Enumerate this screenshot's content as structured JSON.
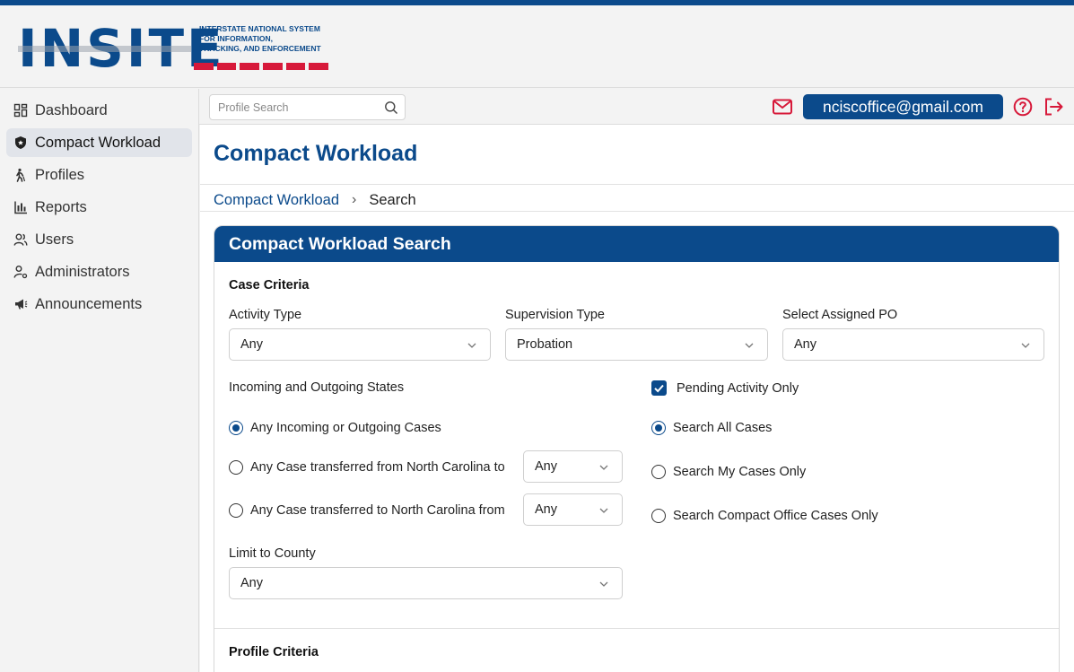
{
  "logo": {
    "word": "INSITE",
    "tagline": [
      "INTERSTATE NATIONAL SYSTEM",
      "FOR INFORMATION,",
      "TRACKING, AND ENFORCEMENT"
    ]
  },
  "colors": {
    "brand_blue": "#0b4a8b",
    "accent_red": "#d7193a"
  },
  "sidebar": {
    "items": [
      {
        "label": "Dashboard",
        "icon": "dashboard-icon",
        "active": false
      },
      {
        "label": "Compact Workload",
        "icon": "shield-icon",
        "active": true
      },
      {
        "label": "Profiles",
        "icon": "person-walking-icon",
        "active": false
      },
      {
        "label": "Reports",
        "icon": "bar-chart-icon",
        "active": false
      },
      {
        "label": "Users",
        "icon": "users-icon",
        "active": false
      },
      {
        "label": "Administrators",
        "icon": "admin-user-icon",
        "active": false
      },
      {
        "label": "Announcements",
        "icon": "megaphone-icon",
        "active": false
      }
    ]
  },
  "topbar": {
    "search_placeholder": "Profile Search",
    "user_email": "nciscoffice@gmail.com"
  },
  "main": {
    "title": "Compact Workload",
    "breadcrumb": {
      "link": "Compact Workload",
      "separator": "›",
      "current": "Search"
    }
  },
  "card": {
    "title": "Compact Workload Search",
    "case_criteria": "Case Criteria",
    "activity_type": {
      "label": "Activity Type",
      "value": "Any"
    },
    "supervision_type": {
      "label": "Supervision Type",
      "value": "Probation"
    },
    "assigned_po": {
      "label": "Select Assigned PO",
      "value": "Any"
    },
    "states_label": "Incoming and Outgoing States",
    "state_options": [
      {
        "label": "Any Incoming or Outgoing Cases",
        "selected": true
      },
      {
        "label": "Any Case transferred from North Carolina to",
        "selected": false,
        "select_value": "Any"
      },
      {
        "label": "Any Case transferred to North Carolina from",
        "selected": false,
        "select_value": "Any"
      }
    ],
    "pending_only": {
      "label": "Pending Activity Only",
      "checked": true
    },
    "scope_options": [
      {
        "label": "Search All Cases",
        "selected": true
      },
      {
        "label": "Search My Cases Only",
        "selected": false
      },
      {
        "label": "Search Compact Office Cases Only",
        "selected": false
      }
    ],
    "county": {
      "label": "Limit to County",
      "value": "Any"
    },
    "profile_criteria": "Profile Criteria"
  }
}
